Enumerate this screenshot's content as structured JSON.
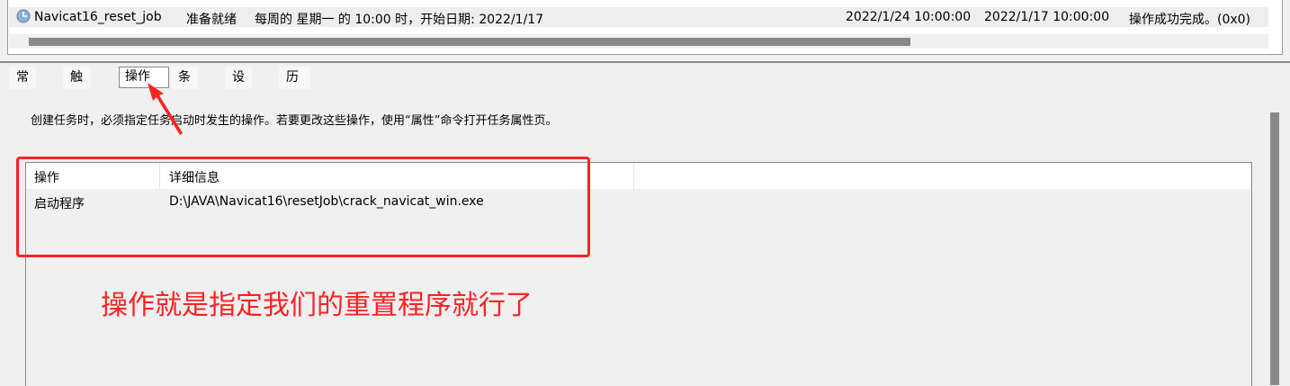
{
  "task_row": {
    "name": "Navicat16_reset_job",
    "status": "准备就绪",
    "trigger": "每周的 星期一 的 10:00 时，开始日期: 2022/1/17",
    "next_run": "2022/1/24 10:00:00",
    "last_run": "2022/1/17 10:00:00",
    "result": "操作成功完成。(0x0)"
  },
  "tabs": [
    "常规",
    "触发器",
    "操作",
    "条件",
    "设置",
    "历史记录(已禁用)"
  ],
  "selected_tab": "操作",
  "description": "创建任务时，必须指定任务启动时发生的操作。若要更改这些操作，使用“属性”命令打开任务属性页。",
  "table": {
    "headers": [
      "操作",
      "详细信息"
    ],
    "rows": [
      [
        "启动程序",
        "D:\\JAVA\\Navicat16\\resetJob\\crack_navicat_win.exe"
      ]
    ]
  },
  "annotation": {
    "text": "操作就是指定我们的重置程序就行了",
    "color": "#ff2222"
  }
}
